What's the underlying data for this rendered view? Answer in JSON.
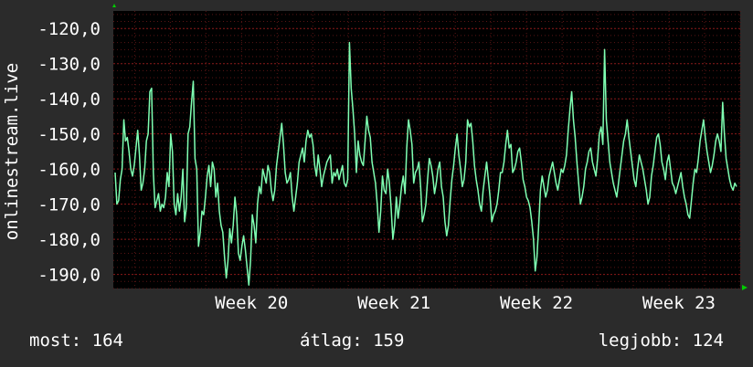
{
  "chart_data": {
    "type": "line",
    "ylabel": "onlinestream.live",
    "y_ticks": [
      "-120,0",
      "-130,0",
      "-140,0",
      "-150,0",
      "-160,0",
      "-170,0",
      "-180,0",
      "-190,0"
    ],
    "y_tick_values": [
      -120,
      -130,
      -140,
      -150,
      -160,
      -170,
      -180,
      -190
    ],
    "ylim": [
      -194,
      -115
    ],
    "x_ticks": [
      "Week 20",
      "Week 21",
      "Week 22",
      "Week 23"
    ],
    "x_tick_positions": [
      1.07,
      2.07,
      3.07,
      4.07
    ],
    "xlim": [
      0.1,
      4.5
    ],
    "grid": true,
    "colors": {
      "line": "#7fffb2",
      "background": "#000000",
      "grid": "#5a1414",
      "major_grid": "#8b1a1a",
      "axis_arrow": "#00cc00"
    },
    "series": [
      {
        "values": [
          -161,
          -170,
          -169,
          -163,
          -160,
          -146,
          -152,
          -151,
          -155,
          -160,
          -162,
          -159,
          -154,
          -149,
          -156,
          -166,
          -164,
          -160,
          -152,
          -150,
          -138,
          -137,
          -161,
          -171,
          -169,
          -167,
          -172,
          -170,
          -171,
          -168,
          -161,
          -165,
          -150,
          -155,
          -170,
          -173,
          -167,
          -172,
          -168,
          -160,
          -175,
          -171,
          -150,
          -148,
          -141,
          -135,
          -157,
          -160,
          -182,
          -178,
          -172,
          -173,
          -168,
          -162,
          -159,
          -165,
          -158,
          -160,
          -168,
          -164,
          -172,
          -176,
          -178,
          -185,
          -191,
          -186,
          -177,
          -181,
          -176,
          -168,
          -173,
          -184,
          -186,
          -182,
          -179,
          -183,
          -188,
          -193,
          -186,
          -173,
          -176,
          -181,
          -170,
          -165,
          -167,
          -160,
          -162,
          -164,
          -159,
          -161,
          -166,
          -169,
          -166,
          -159,
          -155,
          -151,
          -147,
          -153,
          -161,
          -164,
          -163,
          -161,
          -168,
          -172,
          -168,
          -164,
          -158,
          -156,
          -154,
          -158,
          -152,
          -149,
          -151,
          -150,
          -153,
          -159,
          -162,
          -156,
          -160,
          -165,
          -162,
          -160,
          -158,
          -157,
          -156,
          -164,
          -161,
          -162,
          -160,
          -163,
          -161,
          -159,
          -164,
          -165,
          -163,
          -124,
          -137,
          -143,
          -150,
          -161,
          -152,
          -156,
          -158,
          -159,
          -152,
          -145,
          -149,
          -151,
          -158,
          -161,
          -164,
          -170,
          -178,
          -172,
          -162,
          -166,
          -167,
          -160,
          -164,
          -171,
          -180,
          -176,
          -168,
          -174,
          -170,
          -165,
          -162,
          -167,
          -154,
          -146,
          -149,
          -153,
          -164,
          -161,
          -160,
          -158,
          -165,
          -175,
          -173,
          -170,
          -163,
          -157,
          -159,
          -162,
          -167,
          -164,
          -160,
          -158,
          -165,
          -168,
          -175,
          -179,
          -176,
          -169,
          -163,
          -159,
          -154,
          -150,
          -156,
          -160,
          -165,
          -163,
          -158,
          -146,
          -148,
          -147,
          -152,
          -159,
          -163,
          -166,
          -170,
          -172,
          -166,
          -162,
          -158,
          -163,
          -168,
          -175,
          -173,
          -172,
          -170,
          -166,
          -161,
          -161,
          -158,
          -153,
          -149,
          -154,
          -153,
          -161,
          -160,
          -158,
          -155,
          -154,
          -158,
          -163,
          -165,
          -168,
          -169,
          -171,
          -175,
          -180,
          -189,
          -185,
          -176,
          -166,
          -162,
          -165,
          -168,
          -166,
          -162,
          -160,
          -158,
          -161,
          -164,
          -166,
          -163,
          -160,
          -161,
          -159,
          -156,
          -149,
          -143,
          -138,
          -146,
          -151,
          -158,
          -164,
          -170,
          -168,
          -165,
          -160,
          -158,
          -155,
          -154,
          -158,
          -160,
          -162,
          -157,
          -150,
          -148,
          -153,
          -126,
          -146,
          -152,
          -158,
          -161,
          -164,
          -166,
          -168,
          -164,
          -160,
          -156,
          -152,
          -150,
          -146,
          -151,
          -155,
          -159,
          -163,
          -165,
          -160,
          -156,
          -158,
          -160,
          -163,
          -166,
          -170,
          -168,
          -162,
          -159,
          -155,
          -151,
          -150,
          -153,
          -158,
          -160,
          -163,
          -158,
          -156,
          -160,
          -164,
          -165,
          -167,
          -165,
          -163,
          -161,
          -165,
          -168,
          -170,
          -173,
          -174,
          -169,
          -164,
          -160,
          -161,
          -157,
          -152,
          -149,
          -146,
          -151,
          -155,
          -158,
          -161,
          -159,
          -156,
          -152,
          -150,
          -152,
          -155,
          -141,
          -150,
          -157,
          -160,
          -163,
          -165,
          -166,
          -164,
          -165
        ]
      }
    ]
  },
  "footer": {
    "now": "most: 164",
    "avg": "átlag: 159",
    "best": "legjobb: 124"
  }
}
